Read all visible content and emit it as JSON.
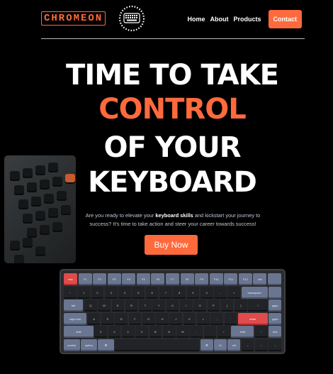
{
  "header": {
    "logo_text": "CHROMEON",
    "nav": [
      {
        "label": "Home"
      },
      {
        "label": "About"
      },
      {
        "label": "Products"
      }
    ],
    "contact_label": "Contact"
  },
  "hero": {
    "line1": "TIME TO TAKE",
    "line2": "CONTROL",
    "line3": "OF YOUR",
    "line4": "KEYBOARD",
    "desc_before": "Are you ready to elevate your ",
    "desc_bold": "keyboard skills",
    "desc_after": " and kickstart your journey to success? It's time to take action and steer your career towards success!",
    "buy_label": "Buy Now"
  },
  "colors": {
    "accent": "#ff6a3d",
    "background": "#000000",
    "key_mod": "#6a7590",
    "key_red": "#e04b4b"
  },
  "keyboard": {
    "rows": [
      [
        {
          "label": "esc",
          "style": "red"
        },
        {
          "label": "F1",
          "style": "mod"
        },
        {
          "label": "F2",
          "style": "mod"
        },
        {
          "label": "F3",
          "style": "mod"
        },
        {
          "label": "F4",
          "style": "mod"
        },
        {
          "label": "F5",
          "style": "mod"
        },
        {
          "label": "F6",
          "style": "mod"
        },
        {
          "label": "F7",
          "style": "mod"
        },
        {
          "label": "F8",
          "style": "mod"
        },
        {
          "label": "F9",
          "style": "mod"
        },
        {
          "label": "F10",
          "style": "mod"
        },
        {
          "label": "F11",
          "style": "mod"
        },
        {
          "label": "F12",
          "style": "mod"
        },
        {
          "label": "del",
          "style": "mod"
        },
        {
          "label": "",
          "style": "mod"
        }
      ],
      [
        {
          "label": "~",
          "style": ""
        },
        {
          "label": "1",
          "style": ""
        },
        {
          "label": "2",
          "style": ""
        },
        {
          "label": "3",
          "style": ""
        },
        {
          "label": "4",
          "style": ""
        },
        {
          "label": "5",
          "style": ""
        },
        {
          "label": "6",
          "style": ""
        },
        {
          "label": "7",
          "style": ""
        },
        {
          "label": "8",
          "style": ""
        },
        {
          "label": "9",
          "style": ""
        },
        {
          "label": "0",
          "style": ""
        },
        {
          "label": "-",
          "style": ""
        },
        {
          "label": "=",
          "style": ""
        },
        {
          "label": "backspace",
          "style": "mod",
          "w": 2
        },
        {
          "label": "",
          "style": "mod"
        }
      ],
      [
        {
          "label": "tab",
          "style": "mod",
          "w": 1.5
        },
        {
          "label": "Q",
          "style": ""
        },
        {
          "label": "W",
          "style": ""
        },
        {
          "label": "E",
          "style": ""
        },
        {
          "label": "R",
          "style": ""
        },
        {
          "label": "T",
          "style": ""
        },
        {
          "label": "Y",
          "style": ""
        },
        {
          "label": "U",
          "style": ""
        },
        {
          "label": "I",
          "style": ""
        },
        {
          "label": "O",
          "style": ""
        },
        {
          "label": "P",
          "style": ""
        },
        {
          "label": "[",
          "style": ""
        },
        {
          "label": "]",
          "style": ""
        },
        {
          "label": "\\",
          "style": "",
          "w": 1.5
        },
        {
          "label": "pgup",
          "style": "mod"
        }
      ],
      [
        {
          "label": "caps lock",
          "style": "mod",
          "w": 1.75
        },
        {
          "label": "A",
          "style": ""
        },
        {
          "label": "S",
          "style": ""
        },
        {
          "label": "D",
          "style": ""
        },
        {
          "label": "F",
          "style": ""
        },
        {
          "label": "G",
          "style": ""
        },
        {
          "label": "H",
          "style": ""
        },
        {
          "label": "J",
          "style": ""
        },
        {
          "label": "K",
          "style": ""
        },
        {
          "label": "L",
          "style": ""
        },
        {
          "label": ";",
          "style": ""
        },
        {
          "label": "'",
          "style": ""
        },
        {
          "label": "enter",
          "style": "red",
          "w": 2.25
        },
        {
          "label": "pgdn",
          "style": "mod"
        }
      ],
      [
        {
          "label": "shift",
          "style": "mod",
          "w": 2.25
        },
        {
          "label": "Z",
          "style": ""
        },
        {
          "label": "X",
          "style": ""
        },
        {
          "label": "C",
          "style": ""
        },
        {
          "label": "V",
          "style": ""
        },
        {
          "label": "B",
          "style": ""
        },
        {
          "label": "N",
          "style": ""
        },
        {
          "label": "M",
          "style": ""
        },
        {
          "label": ",",
          "style": ""
        },
        {
          "label": ".",
          "style": ""
        },
        {
          "label": "/",
          "style": ""
        },
        {
          "label": "shift",
          "style": "mod",
          "w": 1.75
        },
        {
          "label": "↑",
          "style": ""
        },
        {
          "label": "end",
          "style": "mod"
        }
      ],
      [
        {
          "label": "control",
          "style": "mod",
          "w": 1.25
        },
        {
          "label": "option",
          "style": "mod",
          "w": 1.25
        },
        {
          "label": "⌘",
          "style": "mod",
          "w": 1.25
        },
        {
          "label": "",
          "style": "",
          "w": 6.25
        },
        {
          "label": "⌘",
          "style": "mod"
        },
        {
          "label": "fn",
          "style": "mod"
        },
        {
          "label": "ctrl",
          "style": "mod"
        },
        {
          "label": "←",
          "style": ""
        },
        {
          "label": "↓",
          "style": ""
        },
        {
          "label": "→",
          "style": ""
        }
      ]
    ]
  }
}
